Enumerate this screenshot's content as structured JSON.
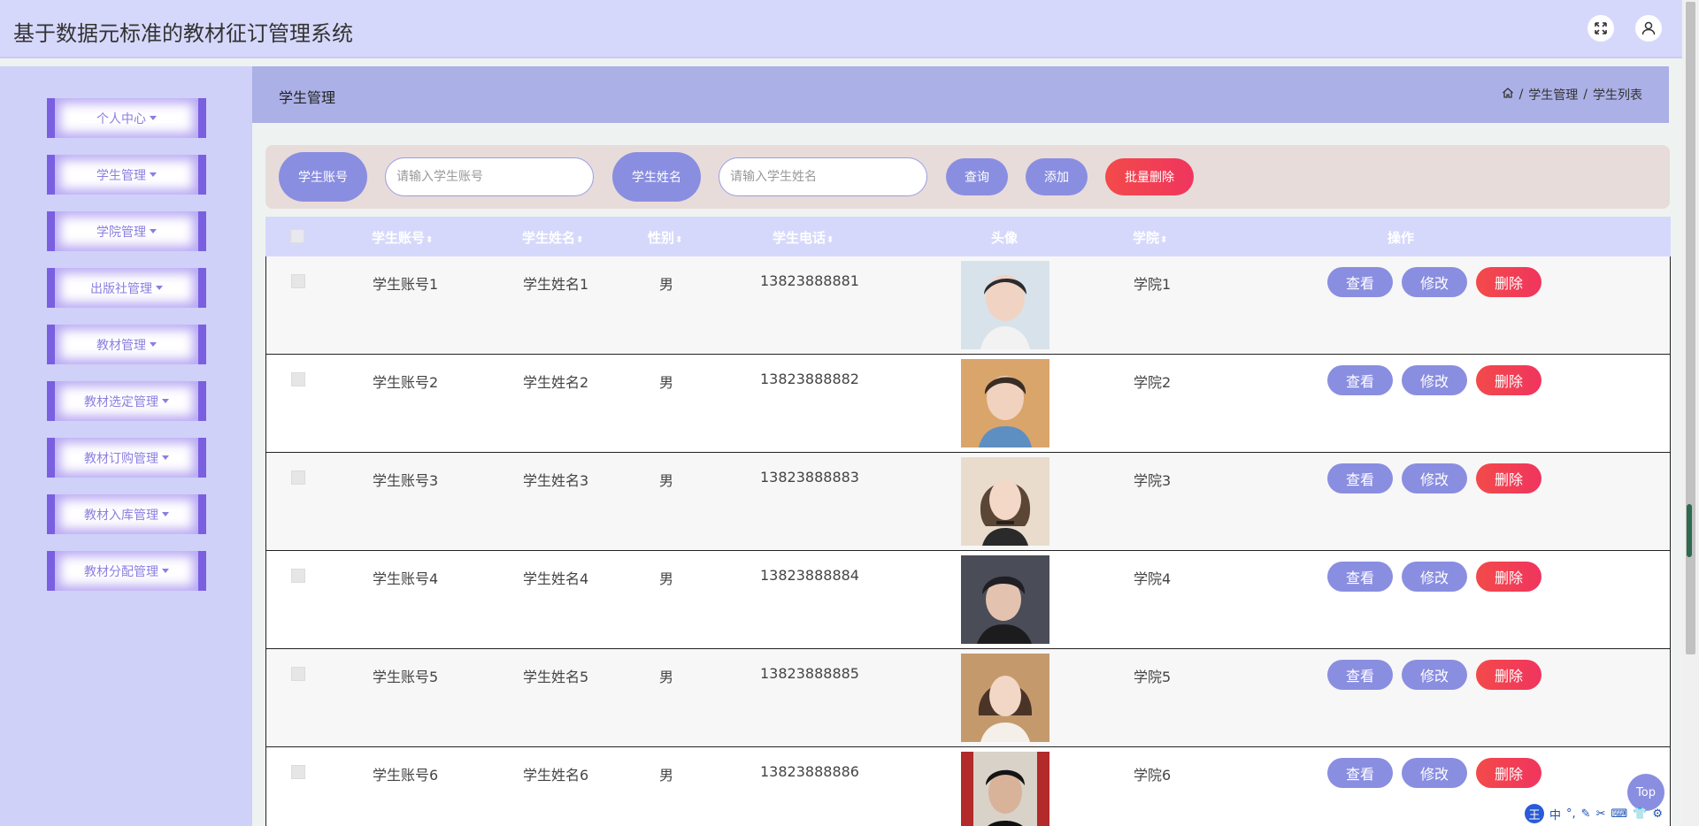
{
  "app": {
    "title": "基于数据元标准的教材征订管理系统"
  },
  "sidebar": {
    "items": [
      {
        "label": "个人中心"
      },
      {
        "label": "学生管理"
      },
      {
        "label": "学院管理"
      },
      {
        "label": "出版社管理"
      },
      {
        "label": "教材管理"
      },
      {
        "label": "教材选定管理"
      },
      {
        "label": "教材订购管理"
      },
      {
        "label": "教材入库管理"
      },
      {
        "label": "教材分配管理"
      }
    ]
  },
  "breadcrumb": {
    "title": "学生管理",
    "path": [
      "学生管理",
      "学生列表"
    ],
    "separator": "/"
  },
  "search": {
    "account_label": "学生账号",
    "account_placeholder": "请输入学生账号",
    "name_label": "学生姓名",
    "name_placeholder": "请输入学生姓名",
    "query_label": "查询",
    "add_label": "添加",
    "batch_delete_label": "批量删除"
  },
  "table": {
    "columns": [
      "学生账号",
      "学生姓名",
      "性别",
      "学生电话",
      "头像",
      "学院",
      "操作"
    ],
    "rows": [
      {
        "account": "学生账号1",
        "name": "学生姓名1",
        "gender": "男",
        "phone": "13823888881",
        "college": "学院1"
      },
      {
        "account": "学生账号2",
        "name": "学生姓名2",
        "gender": "男",
        "phone": "13823888882",
        "college": "学院2"
      },
      {
        "account": "学生账号3",
        "name": "学生姓名3",
        "gender": "男",
        "phone": "13823888883",
        "college": "学院3"
      },
      {
        "account": "学生账号4",
        "name": "学生姓名4",
        "gender": "男",
        "phone": "13823888884",
        "college": "学院4"
      },
      {
        "account": "学生账号5",
        "name": "学生姓名5",
        "gender": "男",
        "phone": "13823888885",
        "college": "学院5"
      },
      {
        "account": "学生账号6",
        "name": "学生姓名6",
        "gender": "男",
        "phone": "13823888886",
        "college": "学院6"
      }
    ],
    "actions": {
      "view": "查看",
      "edit": "修改",
      "delete": "删除"
    }
  },
  "back_to_top": "Top",
  "ime": {
    "logo": "王",
    "mode": "中"
  },
  "colors": {
    "header_bg": "#d6d8fb",
    "sidebar_bg": "#cfd1f8",
    "accent": "#8a8ee0",
    "danger": "#f34a4a",
    "menu_border": "#7a5fe0"
  }
}
